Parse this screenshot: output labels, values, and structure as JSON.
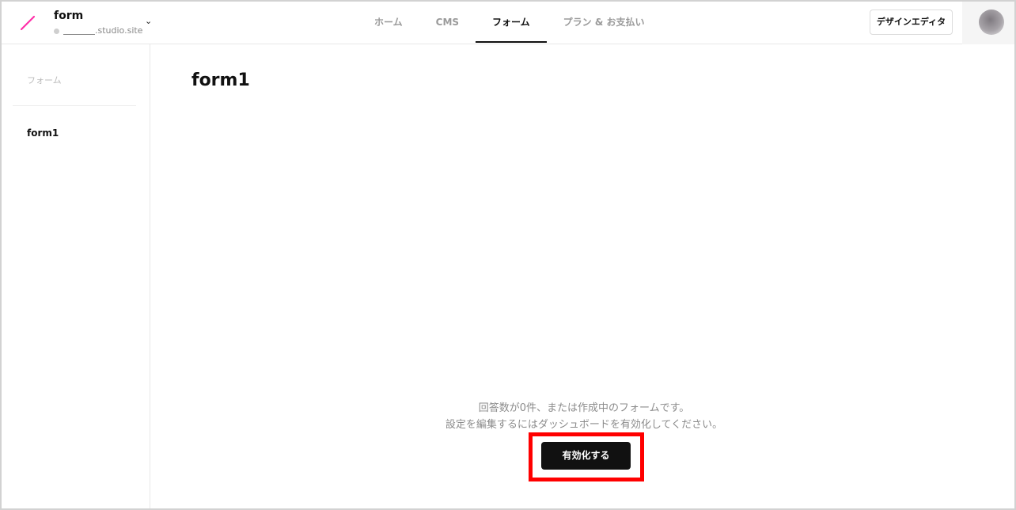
{
  "project": {
    "name": "form",
    "url_suffix": ".studio.site"
  },
  "nav": {
    "tabs": [
      {
        "label": "ホーム",
        "active": false
      },
      {
        "label": "CMS",
        "active": false
      },
      {
        "label": "フォーム",
        "active": true
      },
      {
        "label": "プラン & お支払い",
        "active": false
      }
    ]
  },
  "header": {
    "design_editor_label": "デザインエディタ"
  },
  "sidebar": {
    "heading": "フォーム",
    "items": [
      {
        "label": "form1"
      }
    ]
  },
  "main": {
    "title": "form1",
    "empty_line1": "回答数が0件、または作成中のフォームです。",
    "empty_line2": "設定を編集するにはダッシュボードを有効化してください。",
    "activate_label": "有効化する"
  },
  "colors": {
    "accent_logo": "#ff2fa8",
    "highlight": "#ff0000",
    "button_bg": "#111111"
  }
}
